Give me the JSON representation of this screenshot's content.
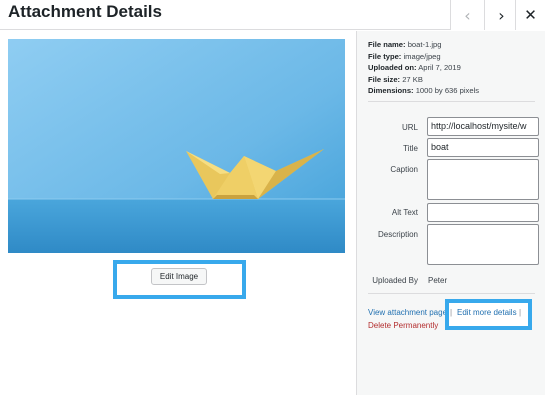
{
  "header": {
    "title": "Attachment Details",
    "prev_icon": "‹",
    "next_icon": "›",
    "close_icon": "✕"
  },
  "colors": {
    "link": "#2271b1",
    "delete": "#b32d2e",
    "highlight": "#38a9ec",
    "sky": "#7ec3ec",
    "boat": "#f2d46a"
  },
  "image": {
    "description_icon": "paper-boat-image"
  },
  "edit_image_label": "Edit Image",
  "file_meta": [
    {
      "label": "File name:",
      "value": "boat-1.jpg"
    },
    {
      "label": "File type:",
      "value": "image/jpeg"
    },
    {
      "label": "Uploaded on:",
      "value": "April 7, 2019"
    },
    {
      "label": "File size:",
      "value": "27 KB"
    },
    {
      "label": "Dimensions:",
      "value": "1000 by 636 pixels"
    }
  ],
  "fields": {
    "url": {
      "label": "URL",
      "value": "http://localhost/mysite/w"
    },
    "title": {
      "label": "Title",
      "value": "boat"
    },
    "caption": {
      "label": "Caption",
      "value": ""
    },
    "alt_text": {
      "label": "Alt Text",
      "value": ""
    },
    "description": {
      "label": "Description",
      "value": ""
    },
    "uploaded_by": {
      "label": "Uploaded By",
      "value": "Peter"
    }
  },
  "actions": {
    "view_attachment": "View attachment page",
    "separator": "|",
    "edit_more_details": "Edit more details",
    "delete_permanently": "Delete Permanently"
  }
}
